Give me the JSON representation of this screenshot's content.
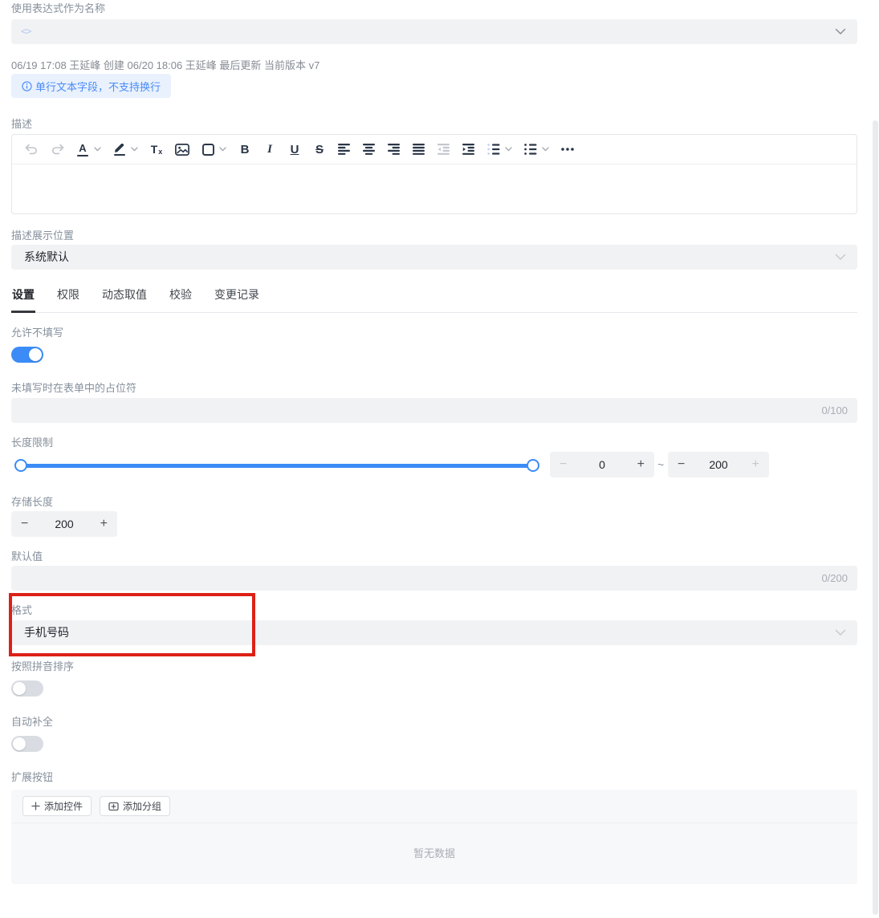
{
  "expression": {
    "label": "使用表达式作为名称",
    "glyph": "<>"
  },
  "meta": "06/19 17:08 王延峰 创建 06/20 18:06 王延峰 最后更新 当前版本 v7",
  "hint_badge": "单行文本字段，不支持换行",
  "description": {
    "label": "描述",
    "toolbar": {
      "font_color": "A",
      "clear_t": "T",
      "clear_x": "x",
      "bold": "B",
      "italic": "I",
      "underline": "U",
      "strike": "S",
      "icons": [
        "undo-icon",
        "redo-icon",
        "font-color-icon",
        "highlight-pen-icon",
        "clear-format-icon",
        "image-icon",
        "table-icon",
        "bold",
        "italic",
        "underline",
        "strikethrough",
        "align-left-icon",
        "align-center-icon",
        "align-right-icon",
        "align-justify-icon",
        "outdent-icon",
        "indent-icon",
        "ordered-list-icon",
        "bullet-list-icon",
        "more-icon"
      ]
    }
  },
  "desc_position": {
    "label": "描述展示位置",
    "value": "系统默认"
  },
  "tabs": [
    {
      "label": "设置",
      "active": true
    },
    {
      "label": "权限",
      "active": false
    },
    {
      "label": "动态取值",
      "active": false
    },
    {
      "label": "校验",
      "active": false
    },
    {
      "label": "变更记录",
      "active": false
    }
  ],
  "allow_blank": {
    "label": "允许不填写",
    "on": true
  },
  "placeholder_field": {
    "label": "未填写时在表单中的占位符",
    "value": "",
    "counter": "0/100"
  },
  "length_limit": {
    "label": "长度限制",
    "min": "0",
    "max": "200",
    "tilde": "~",
    "minus": "−",
    "plus": "+"
  },
  "storage_length": {
    "label": "存储长度",
    "value": "200",
    "minus": "−",
    "plus": "+"
  },
  "default_field": {
    "label": "默认值",
    "value": "",
    "counter": "0/200"
  },
  "format": {
    "label": "格式",
    "value": "手机号码"
  },
  "pinyin_sort": {
    "label": "按照拼音排序",
    "on": false
  },
  "auto_complete": {
    "label": "自动补全",
    "on": false
  },
  "extension": {
    "label": "扩展按钮",
    "add_widget": "添加控件",
    "add_group": "添加分组",
    "empty_text": "暂无数据"
  },
  "colors": {
    "accent": "#3b8cf6",
    "highlight_red": "#dd2117",
    "badge_bg": "#e9f1fd",
    "badge_text": "#4a8bf7"
  }
}
